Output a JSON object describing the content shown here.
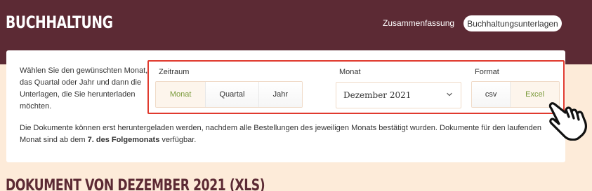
{
  "header": {
    "brand": "BUCHHALTUNG",
    "nav": {
      "summary_label": "Zusammenfassung",
      "documents_label": "Buchhaltungsunterlagen"
    }
  },
  "card": {
    "intro": "Wählen Sie den gewünschten Monat, das Quartal oder Jahr und dann die Unterlagen, die Sie herunterladen möchten.",
    "period": {
      "label": "Zeitraum",
      "options": [
        "Monat",
        "Quartal",
        "Jahr"
      ],
      "selected": "Monat"
    },
    "month": {
      "label": "Monat",
      "value": "Dezember 2021"
    },
    "format": {
      "label": "Format",
      "options": [
        "csv",
        "Excel"
      ],
      "selected": "Excel"
    },
    "notice_part1": "Die Dokumente können erst heruntergeladen werden, nachdem alle Bestellungen des jeweiligen Monats bestätigt wurden. Dokumente für den laufenden Monat sind ab dem ",
    "notice_bold": "7. des Folgemonats",
    "notice_part2": " verfügbar."
  },
  "document_title": "DOKUMENT VON DEZEMBER 2021 (XLS)",
  "colors": {
    "header_bg": "#5c2a34",
    "page_bg": "#fdebd9",
    "highlight": "#e03a2e",
    "active_text": "#7a9a3a"
  },
  "icons": [
    "chevron-down-icon",
    "pointing-hand-icon"
  ]
}
